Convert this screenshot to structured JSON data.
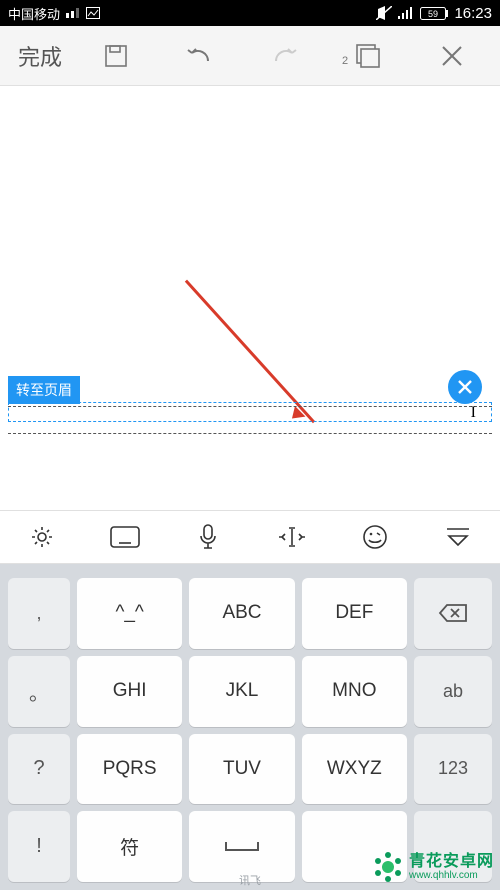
{
  "status": {
    "carrier": "中国移动",
    "battery_pct": "59",
    "time": "16:23"
  },
  "toolbar": {
    "done": "完成",
    "page_count": "2"
  },
  "header": {
    "tag_label": "转至页眉"
  },
  "ime": {
    "brand": "讯飞"
  },
  "keys": {
    "r1": {
      "side_l": ",",
      "k1": "^_^",
      "k2": "ABC",
      "k3": "DEF"
    },
    "r2": {
      "side_l": "。",
      "k1": "GHI",
      "k2": "JKL",
      "k3": "MNO",
      "side_r": "ab"
    },
    "r3": {
      "side_l": "?",
      "k1": "PQRS",
      "k2": "TUV",
      "k3": "WXYZ",
      "side_r": "123"
    },
    "r4": {
      "side_l": "!",
      "k1": "符",
      "k2": "└┘"
    }
  },
  "watermark": {
    "cn": "青花安卓网",
    "url": "www.qhhlv.com"
  }
}
